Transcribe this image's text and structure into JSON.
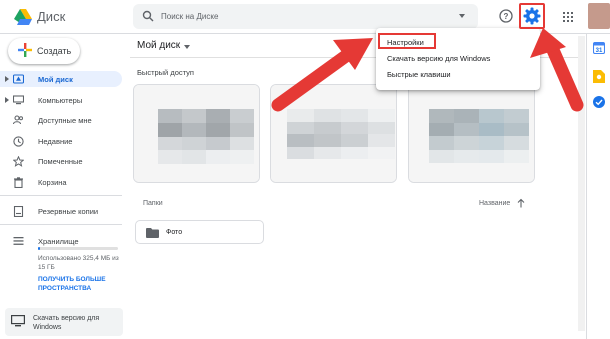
{
  "header": {
    "app_name": "Диск",
    "search_placeholder": "Поиск на Диске"
  },
  "sidebar": {
    "new_button": "Создать",
    "items": [
      {
        "label": "Мой диск",
        "icon": "my-drive-icon",
        "active": true
      },
      {
        "label": "Компьютеры",
        "icon": "computers-icon",
        "active": false
      },
      {
        "label": "Доступные мне",
        "icon": "shared-with-me-icon",
        "active": false
      },
      {
        "label": "Недавние",
        "icon": "recent-icon",
        "active": false
      },
      {
        "label": "Помеченные",
        "icon": "starred-icon",
        "active": false
      },
      {
        "label": "Корзина",
        "icon": "trash-icon",
        "active": false
      },
      {
        "label": "Резервные копии",
        "icon": "backups-icon",
        "active": false
      },
      {
        "label": "Хранилище",
        "icon": "storage-icon",
        "active": false
      }
    ],
    "storage": {
      "usage_text": "Использовано 325,4 МБ из 15 ГБ",
      "used_fraction": 0.022,
      "upgrade_link": "ПОЛУЧИТЬ БОЛЬШЕ ПРОСТРАНСТВА"
    },
    "download_promo": "Скачать версию для Windows"
  },
  "main": {
    "title": "Мой диск",
    "quick_access_label": "Быстрый доступ",
    "folders_label": "Папки",
    "sort_label": "Название",
    "folders": [
      {
        "name": "Фото"
      }
    ]
  },
  "settings_menu": {
    "items": [
      {
        "label": "Настройки",
        "highlighted": true
      },
      {
        "label": "Скачать версию для Windows",
        "highlighted": false
      },
      {
        "label": "Быстрые клавиши",
        "highlighted": false
      }
    ]
  },
  "colors": {
    "accent": "#1a73e8",
    "active_nav_bg": "#e8f0fe",
    "annotation_red": "#e53935",
    "gear": "#1a73e8"
  }
}
